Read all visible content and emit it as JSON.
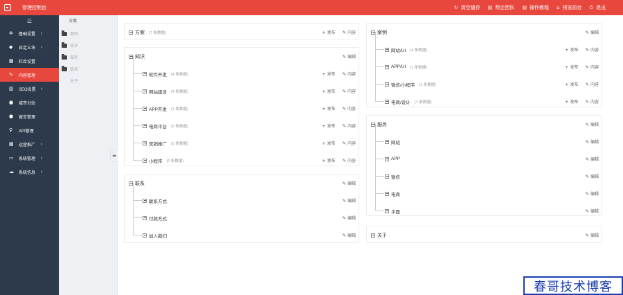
{
  "header": {
    "title": "管理控制台",
    "actions": [
      {
        "icon": "refresh-icon",
        "glyph": "↻",
        "label": "清空缓存"
      },
      {
        "icon": "book-icon",
        "glyph": "▤",
        "label": "帮企团队"
      },
      {
        "icon": "doc-icon",
        "glyph": "▤",
        "label": "操作教程"
      },
      {
        "icon": "home-icon",
        "glyph": "⌂",
        "label": "预览前台"
      },
      {
        "icon": "power-icon",
        "glyph": "⏻",
        "label": "退出"
      }
    ]
  },
  "sidebar": {
    "toggle_glyph": "☰",
    "items": [
      {
        "label": "基础设置",
        "glyph": "✲",
        "arrow": "›"
      },
      {
        "label": "自定义块",
        "glyph": "◆",
        "arrow": "›"
      },
      {
        "label": "栏目设置",
        "glyph": "▦",
        "arrow": ""
      },
      {
        "label": "内容管理",
        "glyph": "✎",
        "arrow": ""
      },
      {
        "label": "SEO设置",
        "glyph": "▥",
        "arrow": "›"
      },
      {
        "label": "城市分站",
        "glyph": "●",
        "arrow": ""
      },
      {
        "label": "留言管理",
        "glyph": "●",
        "arrow": ""
      },
      {
        "label": "API管理",
        "glyph": "⚲",
        "arrow": ""
      },
      {
        "label": "运营推广",
        "glyph": "▦",
        "arrow": "›"
      },
      {
        "label": "系统管理",
        "glyph": "▭",
        "arrow": "›"
      },
      {
        "label": "系统信息",
        "glyph": "☁",
        "arrow": "›"
      }
    ]
  },
  "subnav": {
    "title": "方案",
    "items": [
      "案例",
      "知识",
      "服务",
      "联系"
    ],
    "last": "关于"
  },
  "collapse_glyph": "⇹",
  "actions": {
    "publish": "发布",
    "content": "内容",
    "edit": "编辑",
    "plus_glyph": "+",
    "edit_glyph": "✎"
  },
  "left_column": {
    "fangan": {
      "name": "方案",
      "count": "(7 条数据)"
    },
    "zhishi": {
      "name": "知识",
      "children": [
        {
          "name": "软件开发",
          "count": "(4 条数据)"
        },
        {
          "name": "网站建设",
          "count": "(4 条数据)"
        },
        {
          "name": "APP开发",
          "count": "(1 条数据)"
        },
        {
          "name": "电商平台",
          "count": "(0 条数据)"
        },
        {
          "name": "营销推广",
          "count": "(0 条数据)"
        },
        {
          "name": "小程序",
          "count": "(0 条数据)"
        }
      ]
    },
    "lianxi": {
      "name": "联系",
      "children": [
        {
          "name": "联系方式"
        },
        {
          "name": "付款方式"
        },
        {
          "name": "加入我们"
        }
      ]
    }
  },
  "right_column": {
    "anli": {
      "name": "案例",
      "children": [
        {
          "name": "网站/UI",
          "count": "(4 条数据)"
        },
        {
          "name": "APP/UI",
          "count": "(1 条数据)"
        },
        {
          "name": "微信/小程序",
          "count": "(1 条数据)"
        },
        {
          "name": "电商/设计",
          "count": "(1 条数据)"
        }
      ]
    },
    "fuwu": {
      "name": "服务",
      "children": [
        {
          "name": "网站"
        },
        {
          "name": "APP"
        },
        {
          "name": "微信"
        },
        {
          "name": "电商"
        },
        {
          "name": "平面"
        }
      ]
    },
    "guanyu": {
      "name": "关于"
    }
  },
  "watermark": "春哥技术博客"
}
